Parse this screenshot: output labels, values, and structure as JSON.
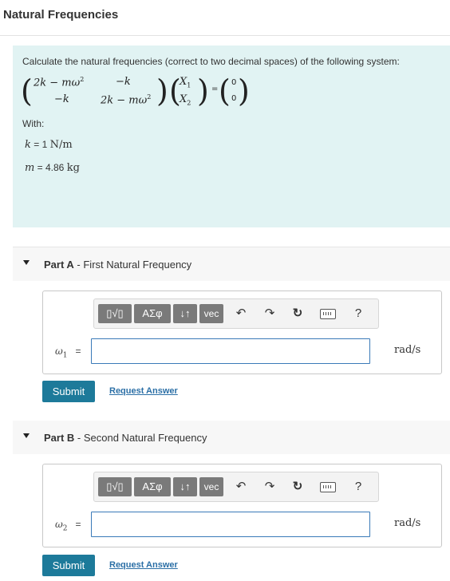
{
  "page_title": "Natural Frequencies",
  "problem": {
    "text": "Calculate the natural frequencies (correct to two decimal spaces) of the following system:",
    "matrix": {
      "a11": "2k − mω",
      "a12": "−k",
      "a21": "−k",
      "a22": "2k − mω",
      "sq": "2",
      "x1": "X",
      "x2": "X",
      "sub1": "1",
      "sub2": "2",
      "equals": "=",
      "zero1": "0",
      "zero2": "0"
    },
    "with_label": "With:",
    "k_var": "k",
    "k_value": " = 1 ",
    "k_unit": "N/m",
    "m_var": "m",
    "m_value": " = 4.86 ",
    "m_unit": "kg"
  },
  "part_a": {
    "prefix": "Part A",
    "title": " - First Natural Frequency",
    "var": "ω",
    "var_sub": "1",
    "equals": "=",
    "input_value": "",
    "unit": "rad/s",
    "submit": "Submit",
    "request": "Request Answer"
  },
  "part_b": {
    "prefix": "Part B",
    "title": " - Second Natural Frequency",
    "var": "ω",
    "var_sub": "2",
    "equals": "=",
    "input_value": "",
    "unit": "rad/s",
    "submit": "Submit",
    "request": "Request Answer"
  },
  "toolbar": {
    "templates_label": "▯√▯",
    "greek_label": "ΑΣφ",
    "arrows_label": "↓↑",
    "vec_label": "vec",
    "undo_icon": "undo-icon",
    "redo_icon": "redo-icon",
    "reset_icon": "reset-icon",
    "keyboard_icon": "keyboard-icon",
    "help_label": "?"
  },
  "colors": {
    "problem_bg": "#e1f3f3",
    "submit_bg": "#1d7a9a",
    "link": "#2b6fa6",
    "input_border": "#3a7ab8"
  }
}
